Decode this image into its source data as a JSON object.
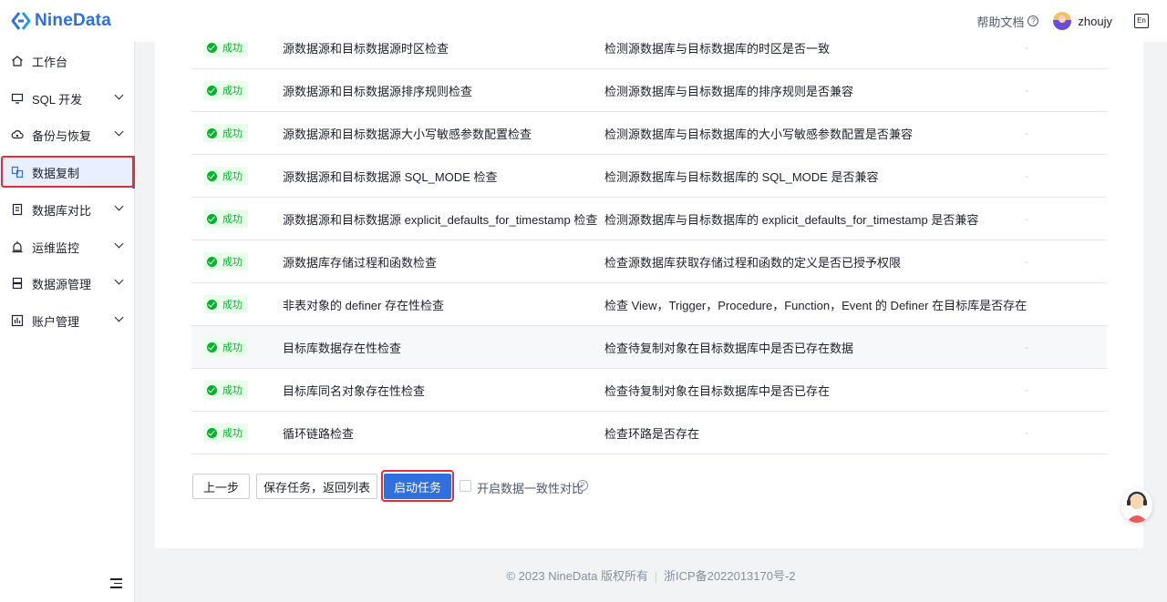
{
  "app": {
    "logo_text": "NineData",
    "help_label": "帮助文档",
    "help_q": "?",
    "username": "zhoujy",
    "lang_icon_text": "En"
  },
  "sidebar": {
    "items": [
      {
        "label": "工作台",
        "icon": "home-icon",
        "expandable": false
      },
      {
        "label": "SQL 开发",
        "icon": "monitor-icon",
        "expandable": true
      },
      {
        "label": "备份与恢复",
        "icon": "cloud-backup-icon",
        "expandable": true
      },
      {
        "label": "数据复制",
        "icon": "copy-data-icon",
        "expandable": false,
        "active": true
      },
      {
        "label": "数据库对比",
        "icon": "compare-icon",
        "expandable": true
      },
      {
        "label": "运维监控",
        "icon": "alarm-icon",
        "expandable": true
      },
      {
        "label": "数据源管理",
        "icon": "datasource-icon",
        "expandable": true
      },
      {
        "label": "账户管理",
        "icon": "account-icon",
        "expandable": true
      }
    ]
  },
  "checks": {
    "status_label": "成功",
    "extra_placeholder": "-",
    "rows": [
      {
        "name": "源数据源和目标数据源时区检查",
        "desc": "检测源数据库与目标数据库的时区是否一致"
      },
      {
        "name": "源数据源和目标数据源排序规则检查",
        "desc": "检测源数据库与目标数据库的排序规则是否兼容"
      },
      {
        "name": "源数据源和目标数据源大小写敏感参数配置检查",
        "desc": "检测源数据库与目标数据库的大小写敏感参数配置是否兼容"
      },
      {
        "name": "源数据源和目标数据源 SQL_MODE 检查",
        "desc": "检测源数据库与目标数据库的 SQL_MODE 是否兼容"
      },
      {
        "name": "源数据源和目标数据源 explicit_defaults_for_timestamp 检查",
        "desc": "检测源数据库与目标数据库的 explicit_defaults_for_timestamp 是否兼容"
      },
      {
        "name": "源数据库存储过程和函数检查",
        "desc": "检查源数据库获取存储过程和函数的定义是否已授予权限"
      },
      {
        "name": "非表对象的 definer 存在性检查",
        "desc": "检查 View，Trigger，Procedure，Function，Event 的 Definer 在目标库是否存在"
      },
      {
        "name": "目标库数据存在性检查",
        "desc": "检查待复制对象在目标数据库中是否已存在数据"
      },
      {
        "name": "目标库同名对象存在性检查",
        "desc": "检查待复制对象在目标数据库中是否已存在"
      },
      {
        "name": "循环链路检查",
        "desc": "检查环路是否存在"
      }
    ]
  },
  "actions": {
    "prev_label": "上一步",
    "save_label": "保存任务，返回列表",
    "start_label": "启动任务",
    "consistency_label": "开启数据一致性对比",
    "consistency_checked": false
  },
  "footer": {
    "copyright": "© 2023 NineData 版权所有",
    "icp": "浙ICP备2022013170号-2"
  },
  "colors": {
    "brand": "#2f6fe0",
    "success": "#00b42a",
    "highlight": "#e0303a"
  }
}
